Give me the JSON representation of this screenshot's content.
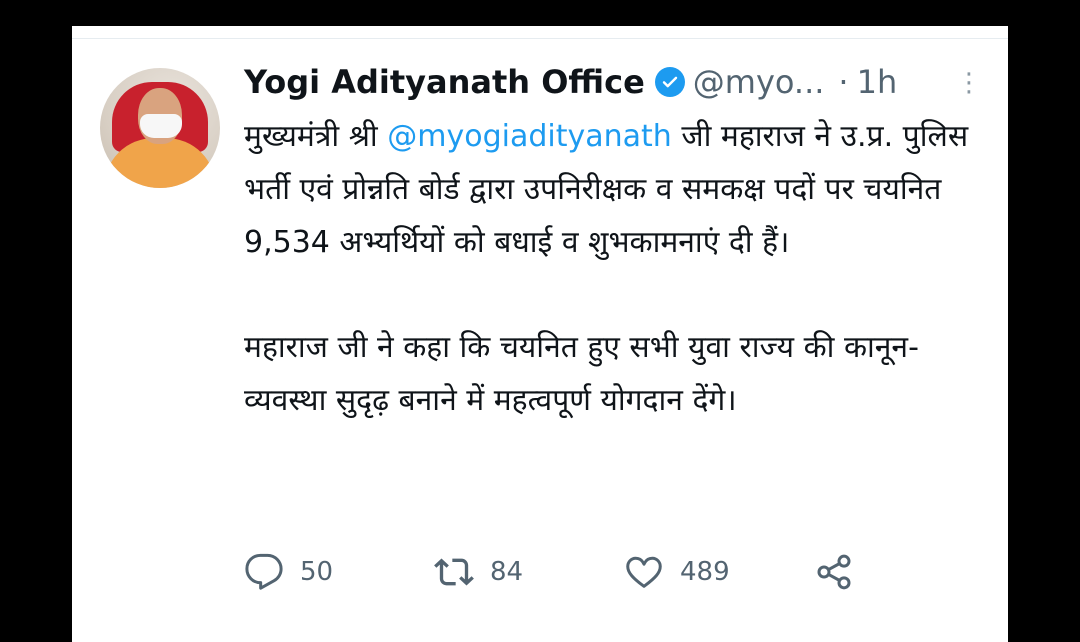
{
  "tweet": {
    "author_name": "Yogi Adityanath Office",
    "handle": "@myo...",
    "separator": "·",
    "time": "1h",
    "more_label": "⋮",
    "text": {
      "p1_before": "मुख्यमंत्री श्री ",
      "mention": "@myogiadityanath",
      "p1_after": " जी महाराज ने उ.प्र. पुलिस भर्ती एवं प्रोन्नति बोर्ड द्वारा उपनिरीक्षक व समकक्ष पदों पर चयनित 9,534 अभ्यर्थियों को बधाई व शुभकामनाएं दी हैं।",
      "p2": "महाराज जी ने कहा कि चयनित हुए सभी युवा राज्य की कानून-व्यवस्था सुदृढ़ बनाने में महत्वपूर्ण योगदान देंगे।"
    }
  },
  "actions": {
    "reply_count": "50",
    "retweet_count": "84",
    "like_count": "489"
  },
  "icons": {
    "reply": "reply-icon",
    "retweet": "retweet-icon",
    "like": "heart-icon",
    "share": "share-icon",
    "verified": "verified-badge-icon",
    "more": "more-options-icon"
  },
  "colors": {
    "accent": "#1d9bf0",
    "text": "#0f1419",
    "secondary": "#536471",
    "background": "#000000"
  }
}
